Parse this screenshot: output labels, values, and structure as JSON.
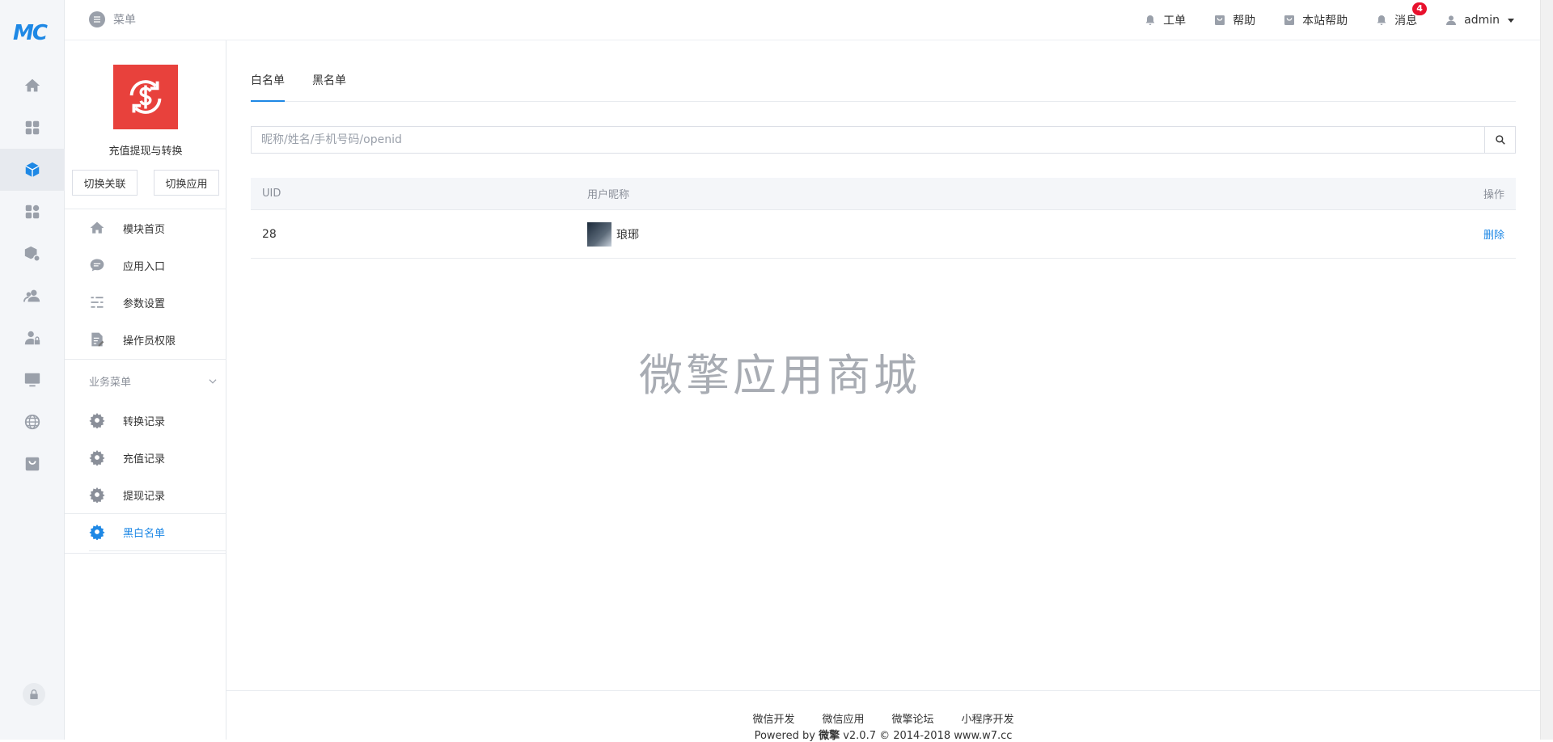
{
  "rail": {
    "logo": "MC",
    "icons": [
      "home-icon",
      "dashboard-icon",
      "module-icon",
      "apps-icon",
      "module-settings-icon",
      "users-icon",
      "user-lock-icon",
      "monitor-icon",
      "globe-icon",
      "store-icon"
    ],
    "active_index": 2,
    "lock_icon": "lock-icon"
  },
  "topbar": {
    "menu_label": "菜单",
    "nav": [
      {
        "label": "工单",
        "icon": "bell-icon"
      },
      {
        "label": "帮助",
        "icon": "bag-icon"
      },
      {
        "label": "本站帮助",
        "icon": "bag-icon"
      },
      {
        "label": "消息",
        "icon": "bell-icon",
        "badge": "4"
      }
    ],
    "user": "admin"
  },
  "module": {
    "name": "充值提现与转换",
    "switch_relation": "切换关联",
    "switch_app": "切换应用",
    "items": [
      {
        "label": "模块首页",
        "icon": "home-icon"
      },
      {
        "label": "应用入口",
        "icon": "chat-icon"
      },
      {
        "label": "参数设置",
        "icon": "list-settings-icon"
      },
      {
        "label": "操作员权限",
        "icon": "edit-doc-icon"
      }
    ],
    "section_title": "业务菜单",
    "business_items": [
      {
        "label": "转换记录",
        "icon": "gear-icon"
      },
      {
        "label": "充值记录",
        "icon": "gear-icon"
      },
      {
        "label": "提现记录",
        "icon": "gear-icon"
      },
      {
        "label": "黑白名单",
        "icon": "gear-icon",
        "active": true
      }
    ]
  },
  "tabs": [
    {
      "label": "白名单",
      "active": true
    },
    {
      "label": "黑名单",
      "active": false
    }
  ],
  "search": {
    "placeholder": "昵称/姓名/手机号码/openid"
  },
  "table": {
    "headers": [
      "UID",
      "用户昵称",
      "操作"
    ],
    "rows": [
      {
        "uid": "28",
        "nickname": "琅琊",
        "action": "删除"
      }
    ]
  },
  "watermark": "微擎应用商城",
  "footer": {
    "links": [
      "微信开发",
      "微信应用",
      "微擎论坛",
      "小程序开发"
    ],
    "powered_prefix": "Powered by ",
    "brand": "微擎",
    "powered_suffix": " v2.0.7 © 2014-2018 www.w7.cc"
  },
  "colors": {
    "accent": "#1e88e5",
    "module_logo": "#e8413c",
    "badge": "#e8112d"
  }
}
